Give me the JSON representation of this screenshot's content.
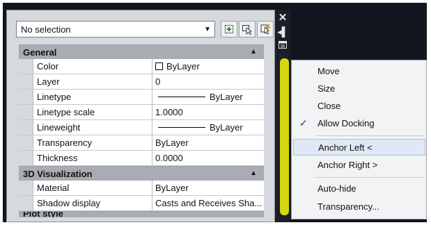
{
  "palette": {
    "selection_value": "No selection",
    "categories": [
      {
        "label": "General",
        "rows": [
          {
            "name": "Color",
            "value": "ByLayer",
            "kind": "color"
          },
          {
            "name": "Layer",
            "value": "0",
            "kind": "text"
          },
          {
            "name": "Linetype",
            "value": "ByLayer",
            "kind": "line"
          },
          {
            "name": "Linetype scale",
            "value": "1.0000",
            "kind": "text"
          },
          {
            "name": "Lineweight",
            "value": "ByLayer",
            "kind": "line"
          },
          {
            "name": "Transparency",
            "value": "ByLayer",
            "kind": "text"
          },
          {
            "name": "Thickness",
            "value": "0.0000",
            "kind": "text"
          }
        ]
      },
      {
        "label": "3D Visualization",
        "rows": [
          {
            "name": "Material",
            "value": "ByLayer",
            "kind": "text"
          },
          {
            "name": "Shadow display",
            "value": "Casts and Receives Sha...",
            "kind": "text"
          }
        ]
      }
    ],
    "partial_category": "Plot style"
  },
  "menu": {
    "items": [
      {
        "label": "Move",
        "checked": false,
        "highlighted": false
      },
      {
        "label": "Size",
        "checked": false,
        "highlighted": false
      },
      {
        "label": "Close",
        "checked": false,
        "highlighted": false
      },
      {
        "label": "Allow Docking",
        "checked": true,
        "highlighted": false
      },
      {
        "label": "Anchor Left  <",
        "checked": false,
        "highlighted": true
      },
      {
        "label": "Anchor Right  >",
        "checked": false,
        "highlighted": false
      },
      {
        "label": "Auto-hide",
        "checked": false,
        "highlighted": false
      },
      {
        "label": "Transparency...",
        "checked": false,
        "highlighted": false
      }
    ]
  },
  "colors": {
    "highlight_marker": "#d6d60f",
    "menu_hover": "#dfe8f4"
  }
}
